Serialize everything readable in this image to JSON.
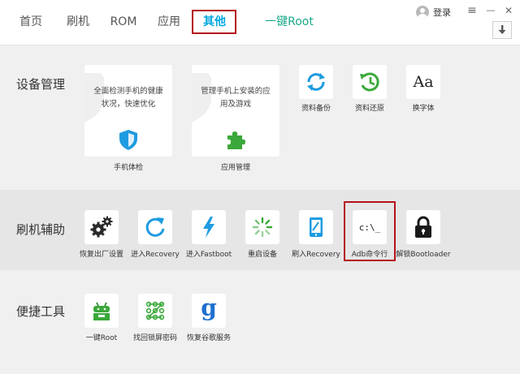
{
  "nav": {
    "tabs": [
      "首页",
      "刷机",
      "ROM",
      "应用",
      "其他"
    ],
    "one_key_root": "一键Root",
    "login": "登录",
    "menu_glyph": "≡",
    "minimize_glyph": "—",
    "close_glyph": "✕"
  },
  "device": {
    "title": "设备管理",
    "cards": [
      {
        "desc": "全面检测手机的健康状况，快速优化",
        "label": "手机体检",
        "icon": "shield-icon"
      },
      {
        "desc": "管理手机上安装的应用及游戏",
        "label": "应用管理",
        "icon": "puzzle-icon"
      }
    ],
    "tools": [
      {
        "label": "资料备份",
        "icon": "sync-icon"
      },
      {
        "label": "资料还原",
        "icon": "clock-restore-icon"
      },
      {
        "label": "换字体",
        "icon": "font-icon",
        "glyph": "Aa"
      }
    ]
  },
  "flash": {
    "title": "刷机辅助",
    "tools": [
      {
        "label": "恢复出厂设置",
        "icon": "gears-icon"
      },
      {
        "label": "进入Recovery",
        "icon": "refresh-arrow-icon"
      },
      {
        "label": "进入Fastboot",
        "icon": "lightning-icon"
      },
      {
        "label": "重启设备",
        "icon": "spinner-icon"
      },
      {
        "label": "刷入Recovery",
        "icon": "phone-edit-icon"
      },
      {
        "label": "Adb命令行",
        "icon": "terminal-icon",
        "glyph": "c:\\_"
      },
      {
        "label": "解锁Bootloader",
        "icon": "padlock-icon"
      }
    ]
  },
  "quick": {
    "title": "便捷工具",
    "tools": [
      {
        "label": "一键Root",
        "icon": "android-root-icon"
      },
      {
        "label": "找回锁屏密码",
        "icon": "pattern-lock-icon"
      },
      {
        "label": "恢复谷歌服务",
        "icon": "google-icon",
        "glyph": "g"
      }
    ]
  },
  "colors": {
    "accent_blue": "#00a8e0",
    "accent_green": "#1aa88a",
    "highlight_red": "#b5121b",
    "icon_green": "#3aa83a"
  }
}
